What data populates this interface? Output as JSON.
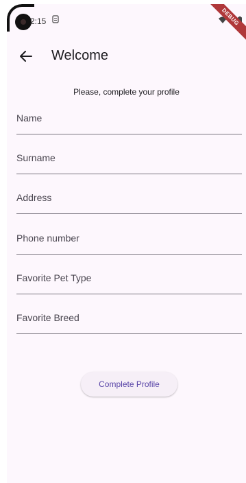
{
  "status_bar": {
    "time": "2:15",
    "debug_label": "DEBUG"
  },
  "app_bar": {
    "title": "Welcome",
    "back_icon": "arrow-left-icon"
  },
  "form": {
    "subtitle": "Please, complete your profile",
    "fields": [
      {
        "placeholder": "Name",
        "value": ""
      },
      {
        "placeholder": "Surname",
        "value": ""
      },
      {
        "placeholder": "Address",
        "value": ""
      },
      {
        "placeholder": "Phone number",
        "value": ""
      },
      {
        "placeholder": "Favorite Pet Type",
        "value": ""
      },
      {
        "placeholder": "Favorite Breed",
        "value": ""
      }
    ],
    "submit_label": "Complete Profile"
  },
  "colors": {
    "background": "#fdf7fd",
    "accent": "#5a46a8",
    "underline": "#79747e",
    "debug_banner": "#b0383a"
  }
}
